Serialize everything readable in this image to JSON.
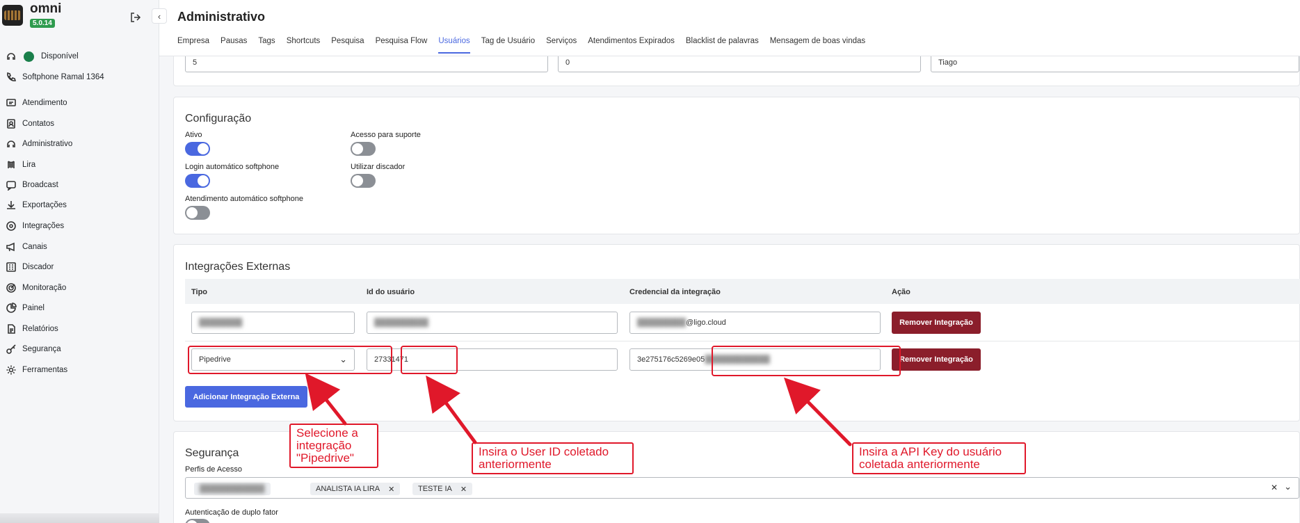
{
  "app": {
    "name": "omni",
    "version": "5.0.14"
  },
  "sidebar": {
    "status": "Disponível",
    "softphone": "Softphone Ramal 1364",
    "items": [
      {
        "label": "Atendimento",
        "icon": "chat-icon"
      },
      {
        "label": "Contatos",
        "icon": "contacts-icon"
      },
      {
        "label": "Administrativo",
        "icon": "admin-icon"
      },
      {
        "label": "Lira",
        "icon": "lira-icon"
      },
      {
        "label": "Broadcast",
        "icon": "broadcast-icon"
      },
      {
        "label": "Exportações",
        "icon": "download-icon"
      },
      {
        "label": "Integrações",
        "icon": "integrations-icon"
      },
      {
        "label": "Canais",
        "icon": "megaphone-icon"
      },
      {
        "label": "Discador",
        "icon": "dialer-icon"
      },
      {
        "label": "Monitoração",
        "icon": "target-icon"
      },
      {
        "label": "Painel",
        "icon": "chart-pie-icon"
      },
      {
        "label": "Relatórios",
        "icon": "report-icon"
      },
      {
        "label": "Segurança",
        "icon": "key-icon"
      },
      {
        "label": "Ferramentas",
        "icon": "gear-icon"
      }
    ]
  },
  "header": {
    "title": "Administrativo",
    "tabs": [
      {
        "label": "Empresa"
      },
      {
        "label": "Pausas"
      },
      {
        "label": "Tags"
      },
      {
        "label": "Shortcuts"
      },
      {
        "label": "Pesquisa"
      },
      {
        "label": "Pesquisa Flow"
      },
      {
        "label": "Usuários",
        "active": true
      },
      {
        "label": "Tag de Usuário"
      },
      {
        "label": "Serviços"
      },
      {
        "label": "Atendimentos Expirados"
      },
      {
        "label": "Blacklist de palavras"
      },
      {
        "label": "Mensagem de boas vindas"
      }
    ]
  },
  "top_fields": [
    "5",
    "0",
    "Tiago"
  ],
  "configuracao": {
    "title": "Configuração",
    "toggles": [
      {
        "label": "Ativo",
        "on": true
      },
      {
        "label": "Acesso para suporte",
        "on": false
      },
      {
        "label": "Login automático softphone",
        "on": true
      },
      {
        "label": "Utilizar discador",
        "on": false
      },
      {
        "label": "Atendimento automático softphone",
        "on": false
      }
    ]
  },
  "integracoes": {
    "title": "Integrações Externas",
    "headers": [
      "Tipo",
      "Id do usuário",
      "Credencial da integração",
      "Ação"
    ],
    "rows": [
      {
        "tipo": "",
        "id": "",
        "credencial_visible": "@ligo.cloud",
        "action": "Remover Integração"
      },
      {
        "tipo": "Pipedrive",
        "id": "27331471",
        "credencial_visible": "3e275176c5269e05",
        "action": "Remover Integração"
      }
    ],
    "add_button": "Adicionar Integração Externa"
  },
  "seguranca": {
    "title": "Segurança",
    "perfis_label": "Perfis de Acesso",
    "chips": [
      "ANALISTA IA LIRA",
      "TESTE IA"
    ],
    "two_factor_label": "Autenticação de duplo fator"
  },
  "annotations": [
    {
      "text": "Selecione a\nintegração\n\"Pipedrive\""
    },
    {
      "text": "Insira o User ID coletado\nanteriormente"
    },
    {
      "text": "Insira a API Key do usuário\ncoletada anteriormente"
    }
  ],
  "colors": {
    "accent": "#4a68e0",
    "danger": "#8b1e2b",
    "annotation": "#e0182a",
    "status": "#1a7f4b"
  }
}
